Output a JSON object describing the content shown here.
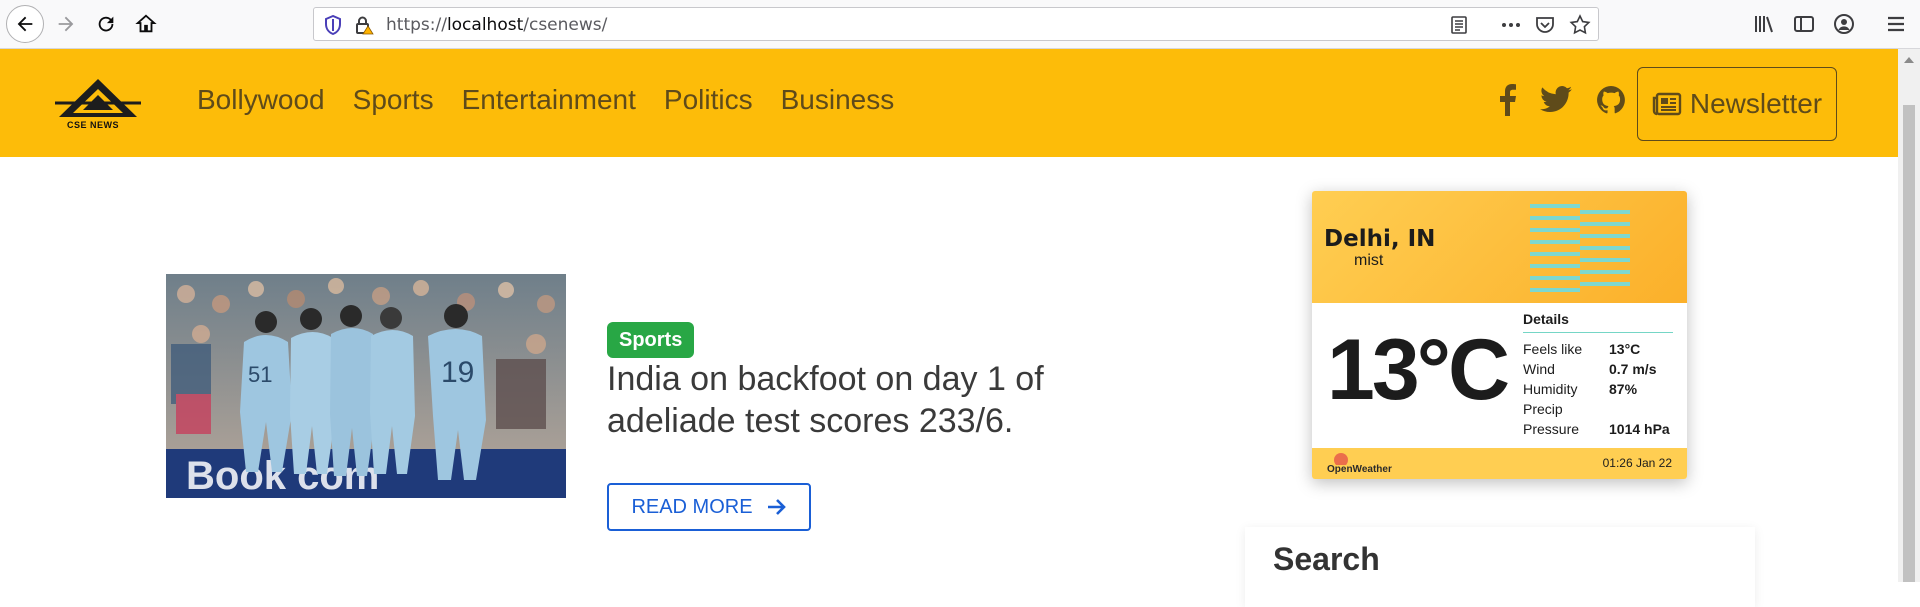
{
  "browser": {
    "url_prefix": "https://",
    "url_host": "localhost",
    "url_path": "/csenews/"
  },
  "site": {
    "logo_text": "CSE NEWS",
    "nav_links": [
      "Bollywood",
      "Sports",
      "Entertainment",
      "Politics",
      "Business"
    ],
    "newsletter_label": "Newsletter",
    "brand_color": "#fdbc09"
  },
  "article": {
    "category": "Sports",
    "headline": "India on backfoot on day 1 of adeliade test scores 233/6.",
    "read_more_label": "READ MORE",
    "badge_color": "#28a745",
    "button_color": "#1a5fd6"
  },
  "weather": {
    "city": "Delhi, IN",
    "description": "mist",
    "temperature": "13°C",
    "details_title": "Details",
    "details": [
      {
        "label": "Feels like",
        "value": "13°C"
      },
      {
        "label": "Wind",
        "value": "0.7 m/s"
      },
      {
        "label": "Humidity",
        "value": "87%"
      },
      {
        "label": "Precip",
        "value": ""
      },
      {
        "label": "Pressure",
        "value": "1014 hPa"
      }
    ],
    "provider": "OpenWeather",
    "timestamp": "01:26 Jan 22"
  },
  "sidebar": {
    "search_title": "Search"
  }
}
